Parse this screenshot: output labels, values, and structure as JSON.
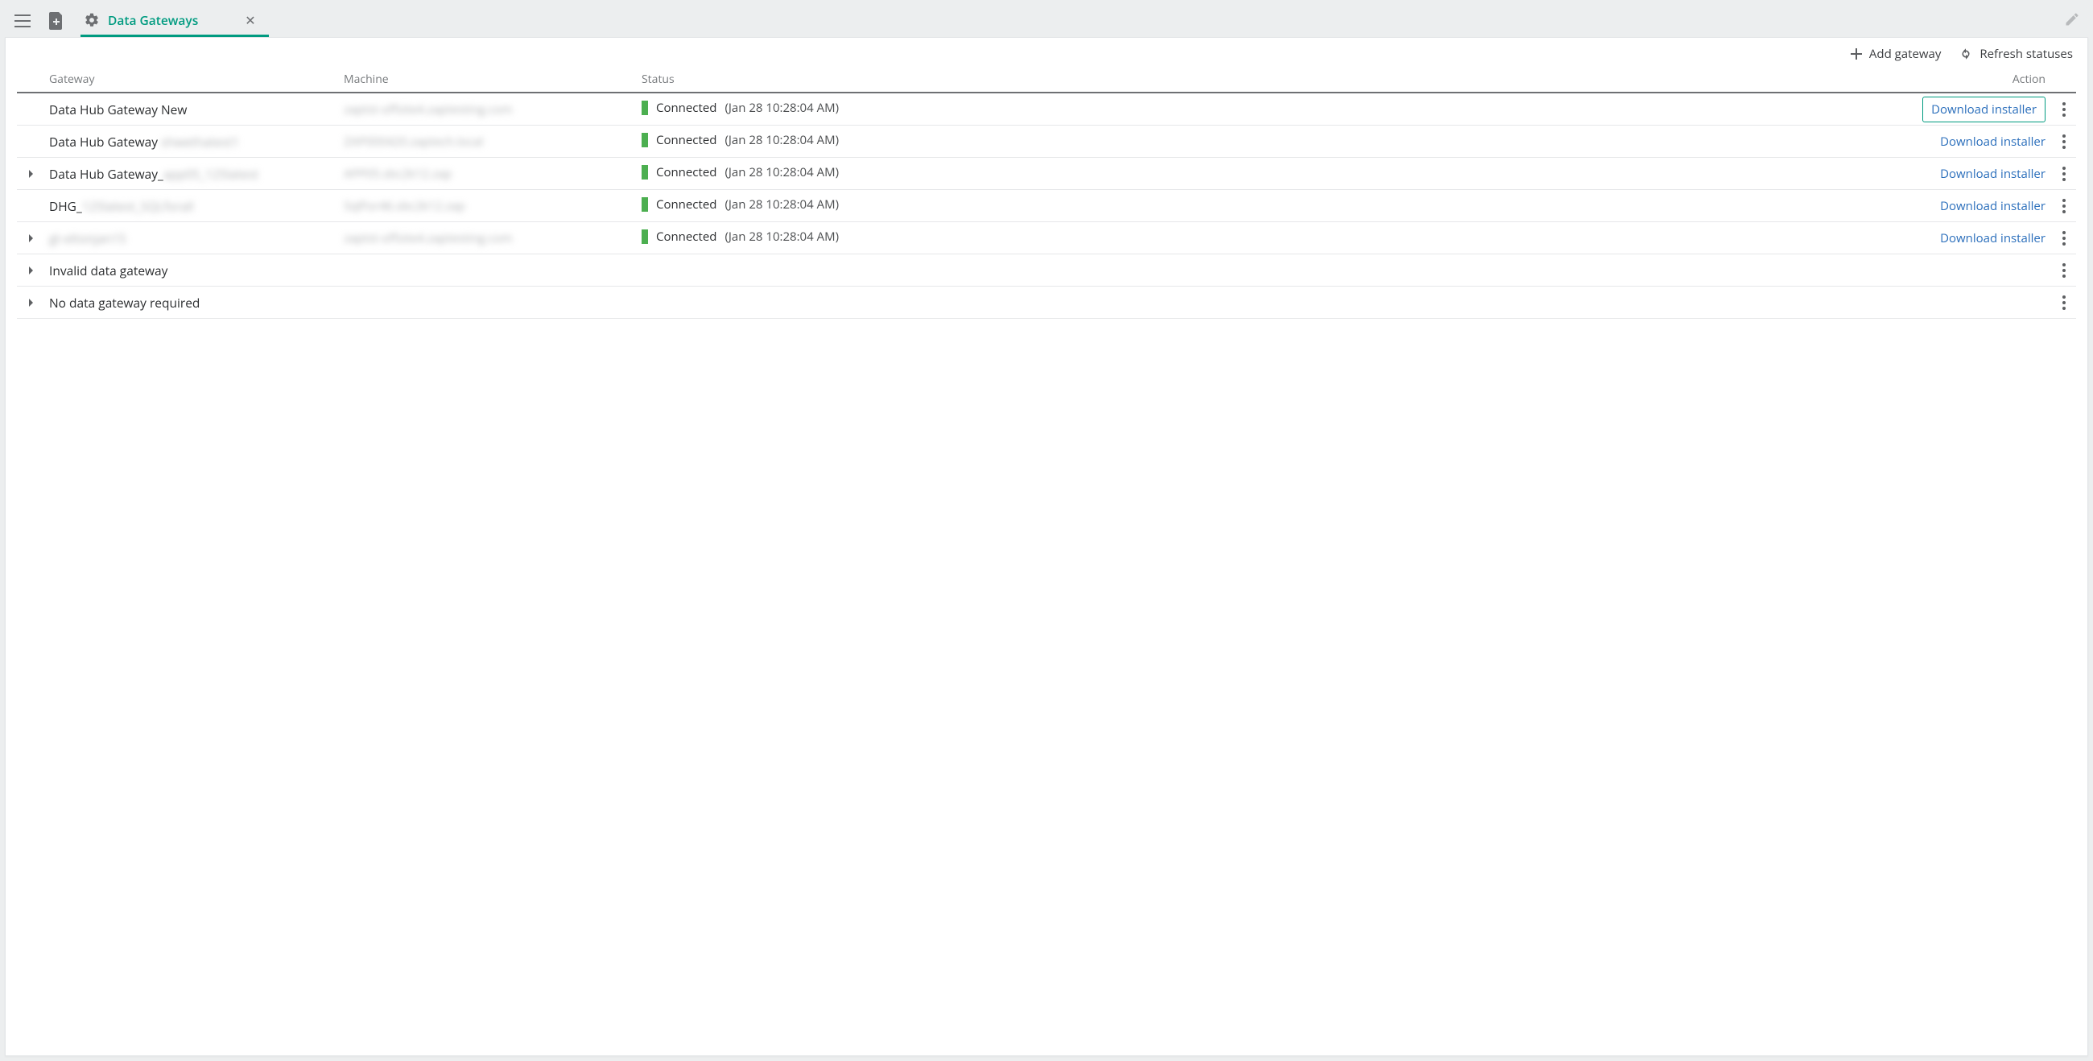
{
  "tab": {
    "label": "Data Gateways"
  },
  "actions": {
    "add_gateway": "Add gateway",
    "refresh_statuses": "Refresh statuses"
  },
  "columns": {
    "gateway": "Gateway",
    "machine": "Machine",
    "status": "Status",
    "action": "Action"
  },
  "status_label": "Connected",
  "status_timestamp": "(Jan 28 10:28:04 AM)",
  "download_label": "Download installer",
  "rows": [
    {
      "expandable": false,
      "name": "Data Hub Gateway New",
      "name_suffix_blur": "",
      "machine_blur": "zaptst-offsite4.zaptesting.com",
      "has_status": true,
      "download_outlined": true,
      "has_action": true
    },
    {
      "expandable": false,
      "name": "Data Hub Gateway ",
      "name_suffix_blur": "shwethatest1",
      "machine_blur": "ZAP000420.zaptech.local",
      "has_status": true,
      "download_outlined": false,
      "has_action": true
    },
    {
      "expandable": true,
      "name": "Data Hub Gateway_",
      "name_suffix_blur": "app05_125latest",
      "machine_blur": "APP05.sbc2k12.zap",
      "has_status": true,
      "download_outlined": false,
      "has_action": true
    },
    {
      "expandable": false,
      "name": "DHG_",
      "name_suffix_blur": "125latest_SQLforall",
      "machine_blur": "SqlFor46.sbc2k12.zap",
      "has_status": true,
      "download_outlined": false,
      "has_action": true
    },
    {
      "expandable": true,
      "name": "",
      "name_suffix_blur": "gt-eltonjan15",
      "machine_blur": "zaptst-offsite4.zaptesting.com",
      "has_status": true,
      "download_outlined": false,
      "has_action": true
    },
    {
      "expandable": true,
      "name": "Invalid data gateway",
      "name_suffix_blur": "",
      "machine_blur": "",
      "has_status": false,
      "download_outlined": false,
      "has_action": false
    },
    {
      "expandable": true,
      "name": "No data gateway required",
      "name_suffix_blur": "",
      "machine_blur": "",
      "has_status": false,
      "download_outlined": false,
      "has_action": false
    }
  ]
}
